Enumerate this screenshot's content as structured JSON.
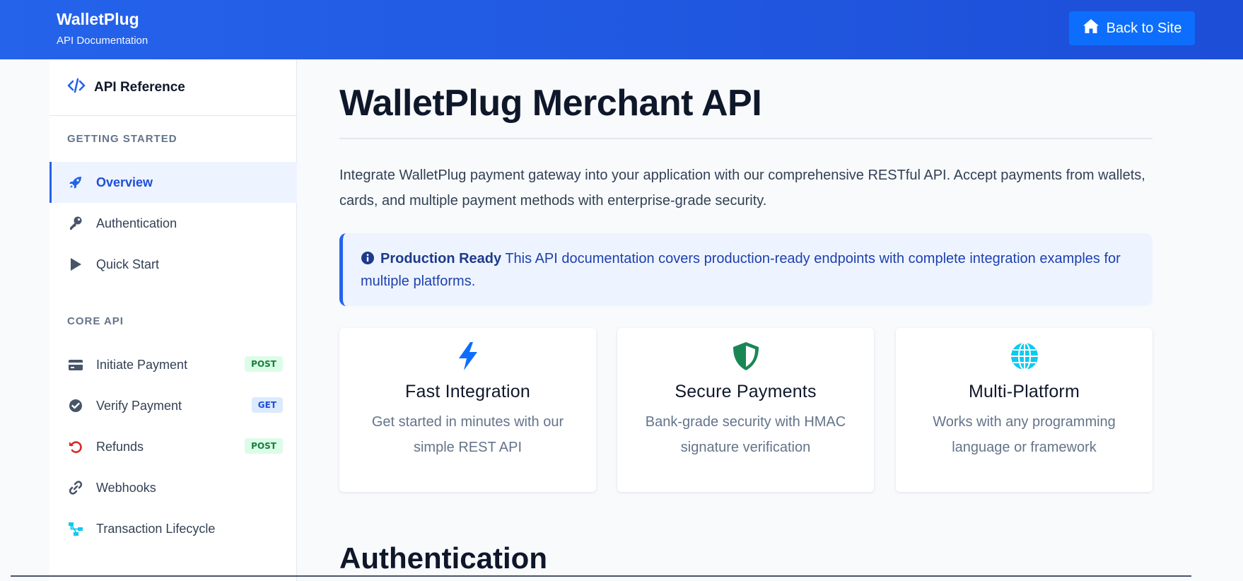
{
  "header": {
    "brand": "WalletPlug",
    "subtitle": "API Documentation",
    "back_label": "Back to Site"
  },
  "sidebar": {
    "title": "API Reference",
    "sections": [
      {
        "label": "GETTING STARTED",
        "items": [
          {
            "label": "Overview",
            "icon": "rocket-icon",
            "active": true
          },
          {
            "label": "Authentication",
            "icon": "key-icon"
          },
          {
            "label": "Quick Start",
            "icon": "play-icon"
          }
        ]
      },
      {
        "label": "CORE API",
        "items": [
          {
            "label": "Initiate Payment",
            "icon": "credit-card-icon",
            "badge": "POST"
          },
          {
            "label": "Verify Payment",
            "icon": "check-circle-icon",
            "badge": "GET"
          },
          {
            "label": "Refunds",
            "icon": "undo-icon",
            "badge": "POST"
          },
          {
            "label": "Webhooks",
            "icon": "link-icon"
          },
          {
            "label": "Transaction Lifecycle",
            "icon": "sitemap-icon"
          }
        ]
      }
    ]
  },
  "main": {
    "title": "WalletPlug Merchant API",
    "intro": "Integrate WalletPlug payment gateway into your application with our comprehensive RESTful API. Accept payments from wallets, cards, and multiple payment methods with enterprise-grade security.",
    "callout": {
      "strong": "Production Ready",
      "text": "This API documentation covers production-ready endpoints with complete integration examples for multiple platforms."
    },
    "cards": [
      {
        "title": "Fast Integration",
        "text": "Get started in minutes with our simple REST API",
        "icon": "bolt-icon",
        "color": "#0d6efd"
      },
      {
        "title": "Secure Payments",
        "text": "Bank-grade security with HMAC signature verification",
        "icon": "shield-icon",
        "color": "#198754"
      },
      {
        "title": "Multi-Platform",
        "text": "Works with any programming language or framework",
        "icon": "globe-icon",
        "color": "#0dcaf0"
      }
    ],
    "next_section": "Authentication"
  },
  "colors": {
    "header": "#2563eb",
    "accent": "#1d4ed8",
    "callout_bg": "#eef4ff"
  }
}
